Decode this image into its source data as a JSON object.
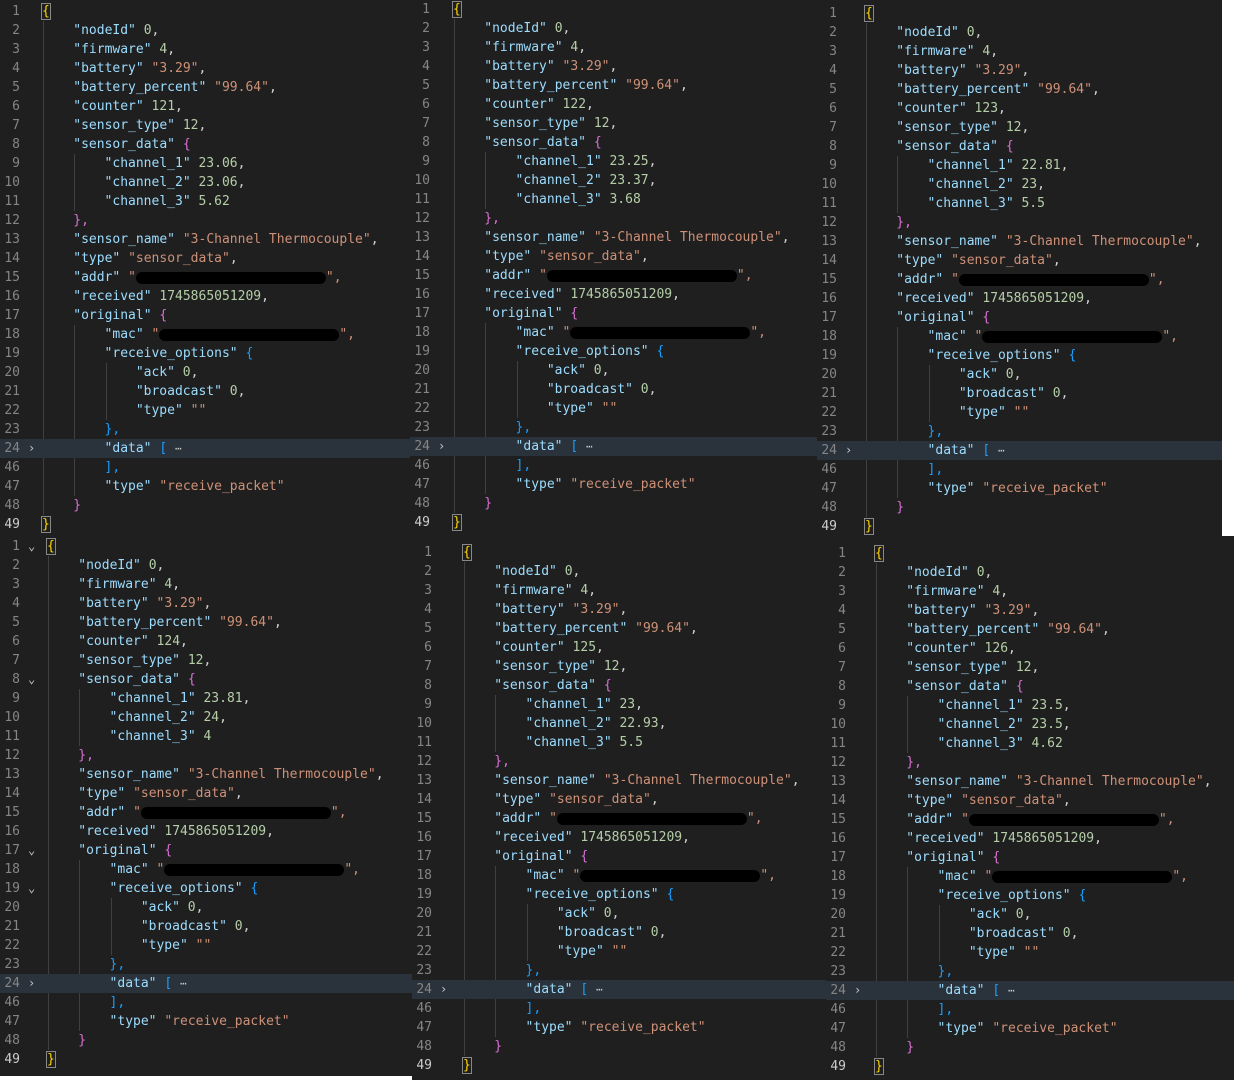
{
  "line_numbers": [
    "1",
    "2",
    "3",
    "4",
    "5",
    "6",
    "7",
    "8",
    "9",
    "10",
    "11",
    "12",
    "13",
    "14",
    "15",
    "16",
    "17",
    "18",
    "19",
    "20",
    "21",
    "22",
    "23",
    "24",
    "46",
    "47",
    "48",
    "49"
  ],
  "tokens": {
    "open_brace": "{",
    "close_brace": "}",
    "close_brace_comma": "},",
    "open_bracket": "[",
    "close_bracket_comma": "],",
    "ellipsis": "⋯",
    "fold_expanded": "⌄",
    "fold_collapsed": "›"
  },
  "keys": {
    "nodeId": "\"nodeId\"",
    "firmware": "\"firmware\"",
    "battery": "\"battery\"",
    "battery_percent": "\"battery_percent\"",
    "counter": "\"counter\"",
    "sensor_type": "\"sensor_type\"",
    "sensor_data": "\"sensor_data\"",
    "channel_1": "\"channel_1\"",
    "channel_2": "\"channel_2\"",
    "channel_3": "\"channel_3\"",
    "sensor_name": "\"sensor_name\"",
    "type": "\"type\"",
    "addr": "\"addr\"",
    "received": "\"received\"",
    "original": "\"original\"",
    "mac": "\"mac\"",
    "receive_options": "\"receive_options\"",
    "ack": "\"ack\"",
    "broadcast": "\"broadcast\"",
    "data": "\"data\""
  },
  "panels": [
    {
      "counter": "121",
      "channel_1": "23.06",
      "channel_2": "23.06",
      "channel_3": "5.62"
    },
    {
      "counter": "122",
      "channel_1": "23.25",
      "channel_2": "23.37",
      "channel_3": "3.68"
    },
    {
      "counter": "123",
      "channel_1": "22.81",
      "channel_2": "23",
      "channel_3": "5.5"
    },
    {
      "counter": "124",
      "channel_1": "23.81",
      "channel_2": "24",
      "channel_3": "4"
    },
    {
      "counter": "125",
      "channel_1": "23",
      "channel_2": "22.93",
      "channel_3": "5.5"
    },
    {
      "counter": "126",
      "channel_1": "23.5",
      "channel_2": "23.5",
      "channel_3": "4.62"
    }
  ],
  "common": {
    "nodeId": "0",
    "firmware": "4",
    "battery": "\"3.29\"",
    "battery_percent": "\"99.64\"",
    "sensor_type": "12",
    "sensor_name": "\"3-Channel Thermocouple\"",
    "type_sensor_data": "\"sensor_data\"",
    "received": "1745865051209",
    "ack": "0",
    "broadcast": "0",
    "type_empty": "\"\"",
    "type_receive_packet": "\"receive_packet\"",
    "redacted_quote_open": "\"",
    "redacted_quote_close": "\","
  },
  "colors": {
    "editor_bg": "#1f1f1f",
    "key": "#9cdcfe",
    "string": "#ce9178",
    "number": "#b5cea8",
    "bracket_level1": "#ffd700",
    "bracket_level2": "#da70d6",
    "bracket_level3": "#179fff"
  }
}
